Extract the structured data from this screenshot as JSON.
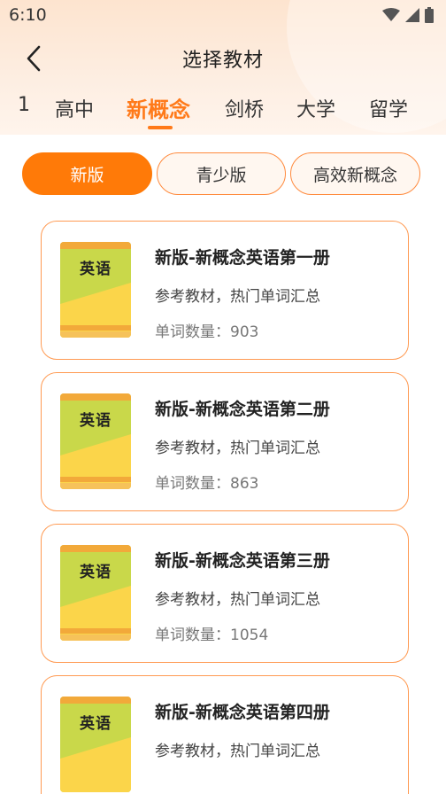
{
  "status_bar": {
    "time": "6:10"
  },
  "nav": {
    "title": "选择教材"
  },
  "tabs": [
    {
      "label": "1",
      "active": false
    },
    {
      "label": "高中",
      "active": false
    },
    {
      "label": "新概念",
      "active": true
    },
    {
      "label": "剑桥",
      "active": false
    },
    {
      "label": "大学",
      "active": false
    },
    {
      "label": "留学",
      "active": false
    }
  ],
  "segments": [
    {
      "label": "新版",
      "active": true
    },
    {
      "label": "青少版",
      "active": false
    },
    {
      "label": "高效新概念",
      "active": false
    }
  ],
  "books": [
    {
      "cover_label": "英语",
      "title": "新版-新概念英语第一册",
      "subtitle": "参考教材，热门单词汇总",
      "count_label": "单词数量：",
      "count": "903"
    },
    {
      "cover_label": "英语",
      "title": "新版-新概念英语第二册",
      "subtitle": "参考教材，热门单词汇总",
      "count_label": "单词数量：",
      "count": "863"
    },
    {
      "cover_label": "英语",
      "title": "新版-新概念英语第三册",
      "subtitle": "参考教材，热门单词汇总",
      "count_label": "单词数量：",
      "count": "1054"
    },
    {
      "cover_label": "英语",
      "title": "新版-新概念英语第四册",
      "subtitle": "参考教材，热门单词汇总",
      "count_label": "",
      "count": ""
    }
  ],
  "colors": {
    "accent": "#ff7a08",
    "book_cover_green": "#c9d84a",
    "book_cover_yellow": "#fbd54a",
    "book_spine": "#f2a93a"
  }
}
